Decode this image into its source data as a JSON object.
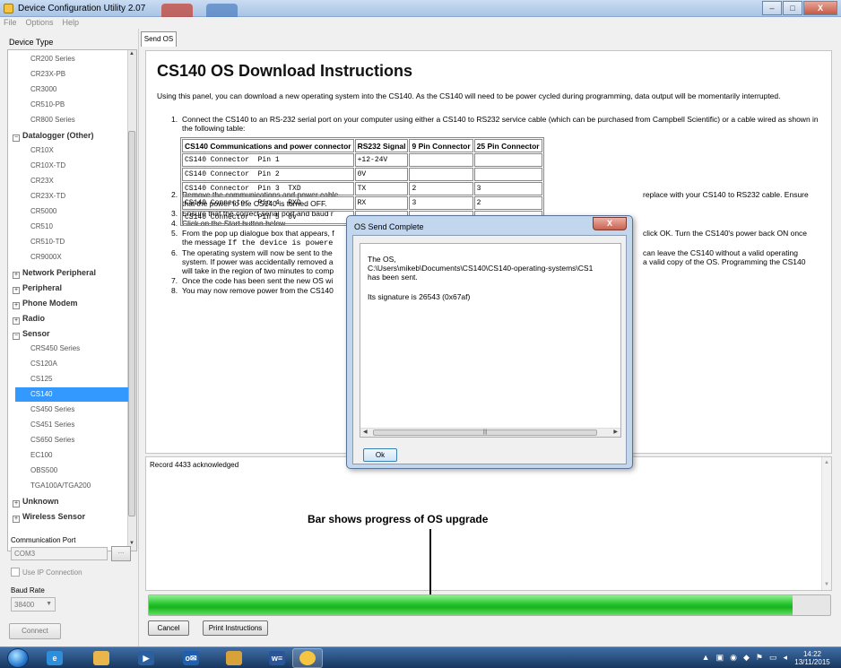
{
  "window": {
    "title": "Device Configuration Utility 2.07",
    "minimize_label": "–",
    "maximize_label": "□",
    "close_label": "X"
  },
  "menu": [
    "File",
    "Options",
    "Help"
  ],
  "left_panel": {
    "header": "Device Type",
    "tree": [
      {
        "kind": "item",
        "label": "CR200 Series"
      },
      {
        "kind": "item",
        "label": "CR23X-PB"
      },
      {
        "kind": "item",
        "label": "CR3000"
      },
      {
        "kind": "item",
        "label": "CR510-PB"
      },
      {
        "kind": "item",
        "label": "CR800 Series"
      },
      {
        "kind": "group",
        "label": "Datalogger (Other)",
        "expanded": true
      },
      {
        "kind": "item",
        "label": "CR10X"
      },
      {
        "kind": "item",
        "label": "CR10X-TD"
      },
      {
        "kind": "item",
        "label": "CR23X"
      },
      {
        "kind": "item",
        "label": "CR23X-TD"
      },
      {
        "kind": "item",
        "label": "CR5000"
      },
      {
        "kind": "item",
        "label": "CR510"
      },
      {
        "kind": "item",
        "label": "CR510-TD"
      },
      {
        "kind": "item",
        "label": "CR9000X"
      },
      {
        "kind": "group",
        "label": "Network Peripheral",
        "expanded": false
      },
      {
        "kind": "group",
        "label": "Peripheral",
        "expanded": false
      },
      {
        "kind": "group",
        "label": "Phone Modem",
        "expanded": false
      },
      {
        "kind": "group",
        "label": "Radio",
        "expanded": false
      },
      {
        "kind": "group",
        "label": "Sensor",
        "expanded": true
      },
      {
        "kind": "item",
        "label": "CRS450 Series"
      },
      {
        "kind": "item",
        "label": "CS120A"
      },
      {
        "kind": "item",
        "label": "CS125"
      },
      {
        "kind": "item",
        "label": "CS140",
        "selected": true
      },
      {
        "kind": "item",
        "label": "CS450 Series"
      },
      {
        "kind": "item",
        "label": "CS451 Series"
      },
      {
        "kind": "item",
        "label": "CS650 Series"
      },
      {
        "kind": "item",
        "label": "EC100"
      },
      {
        "kind": "item",
        "label": "OBS500"
      },
      {
        "kind": "item",
        "label": "TGA100A/TGA200"
      },
      {
        "kind": "group",
        "label": "Unknown",
        "expanded": false
      },
      {
        "kind": "group",
        "label": "Wireless Sensor",
        "expanded": false
      }
    ],
    "comm_port_label": "Communication Port",
    "comm_port_value": "COM3",
    "browse_label": "...",
    "ip_label": "Use IP Connection",
    "baud_label": "Baud Rate",
    "baud_value": "38400",
    "connect_label": "Connect"
  },
  "tab": {
    "label": "Send OS"
  },
  "doc": {
    "heading": "CS140 OS Download Instructions",
    "intro": "Using this panel, you can download a new operating system into the CS140. As the CS140 will need to be power cycled during programming, data output will be momentarily interrupted.",
    "steps": [
      {
        "n": "1.",
        "text": "Connect the CS140 to an RS-232 serial port on your computer using either a CS140 to RS232 service cable (which can be purchased from Campbell Scientific) or a cable wired as shown in the following table:"
      },
      {
        "n": "2.",
        "text": "Remove the communications and power cable",
        "tail": "replace with your CS140 to RS232 cable. Ensure",
        "line2": "that the power to the CS140 is turned OFF."
      },
      {
        "n": "3.",
        "text": "Ensure that the correct serial port and baud r"
      },
      {
        "n": "4.",
        "text": "Click on the Start button below."
      },
      {
        "n": "5.",
        "text": "From the pop up dialogue box that appears, f",
        "tail": "click OK. Turn the CS140's power back ON once",
        "line2_pre": "the message ",
        "line2_code": "If the device is powere"
      },
      {
        "n": "6.",
        "text": "The operating system will now be sent to the",
        "tail": "can leave the CS140 without a valid operating",
        "line2": "system. If power was accidentally removed a",
        "tail2": "a valid copy of the OS. Programming the CS140",
        "line3": "will take in the region of two minutes to comp"
      },
      {
        "n": "7.",
        "text": "Once the code has been sent the new OS wi"
      },
      {
        "n": "8.",
        "text": "You may now remove power from the CS140"
      }
    ],
    "table": {
      "headers": [
        "CS140 Communications and power connector",
        "RS232 Signal",
        "9 Pin Connector",
        "25 Pin Connector"
      ],
      "rows": [
        [
          "CS140 Connector  Pin 1",
          "+12-24V",
          "",
          ""
        ],
        [
          "CS140 Connector  Pin 2",
          "0V",
          "",
          ""
        ],
        [
          "CS140 Connector  Pin 3  TXD",
          "TX",
          "2",
          "3"
        ],
        [
          "CS140 Connector  Pin 4  RXD",
          "RX",
          "3",
          "2"
        ],
        [
          "CS140 Connector  Pin 5  0V",
          "",
          "",
          ""
        ]
      ]
    }
  },
  "log": {
    "line": "Record 4433 acknowledged"
  },
  "annotation": "Bar shows progress of OS upgrade",
  "progress": {
    "fraction": 0.945
  },
  "buttons": {
    "cancel": "Cancel",
    "print": "Print Instructions"
  },
  "dialog": {
    "title": "OS Send Complete",
    "close_label": "X",
    "lines": [
      "The OS,",
      "C:\\Users\\mikeb\\Documents\\CS140\\CS140-operating-systems\\CS1",
      "has been sent.",
      "",
      "Its signature is 26543 (0x67af)"
    ],
    "ok_label": "Ok"
  },
  "taskbar": {
    "apps": [
      "ie-icon",
      "explorer-icon",
      "media-player-icon",
      "outlook-icon",
      "paint-icon",
      "word-icon",
      "device-config-icon"
    ],
    "outlook_label": "o✉",
    "word_label": "w≡",
    "time": "14:22",
    "date": "13/11/2015"
  },
  "colors": {
    "progress": "#22c42a",
    "selection": "#3399ff",
    "taskbar": "#1f4a7c"
  }
}
